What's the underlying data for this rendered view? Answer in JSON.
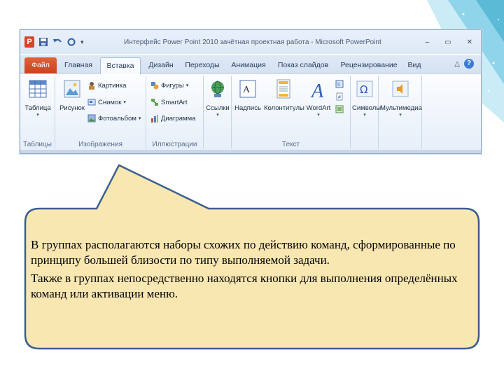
{
  "window": {
    "title": "Интерфейс Power Point 2010 зачётная проектная работа - Microsoft PowerPoint",
    "app_icon": "P",
    "controls": [
      "–",
      "▭",
      "✕"
    ]
  },
  "tabs": [
    {
      "label": "Файл"
    },
    {
      "label": "Главная"
    },
    {
      "label": "Вставка"
    },
    {
      "label": "Дизайн"
    },
    {
      "label": "Переходы"
    },
    {
      "label": "Анимация"
    },
    {
      "label": "Показ слайдов"
    },
    {
      "label": "Рецензирование"
    },
    {
      "label": "Вид"
    }
  ],
  "help_label": "?",
  "groups": {
    "tables": {
      "label": "Таблицы",
      "table_button": "Таблица"
    },
    "images": {
      "label": "Изображения",
      "picture_button": "Рисунок",
      "clipart": "Картинка",
      "screenshot": "Снимок",
      "photoalbum": "Фотоальбом"
    },
    "illustrations": {
      "label": "Иллюстрации",
      "shapes": "Фигуры",
      "smartart": "SmartArt",
      "chart": "Диаграмма"
    },
    "links": {
      "label": "",
      "links_button": "Ссылки"
    },
    "text": {
      "label": "Текст",
      "textbox": "Надпись",
      "headerfooter": "Колонтитулы",
      "wordart": "WordArt"
    },
    "symbols": {
      "label": "",
      "symbols_button": "Символы"
    },
    "media": {
      "label": "",
      "media_button": "Мультимедиа"
    }
  },
  "callout": {
    "paragraph1": " В группах располагаются наборы схожих по действию команд, сформированные по принципу большей близости по типу выполняемой задачи.",
    "paragraph2": "Также в группах непосредственно находятся кнопки для выполнения определённых команд или активации меню."
  },
  "colors": {
    "callout_fill": "#f9e7b2",
    "callout_border": "#3d5f8f",
    "file_tab": "#d24726",
    "corner_accent": "#5bbad5"
  }
}
